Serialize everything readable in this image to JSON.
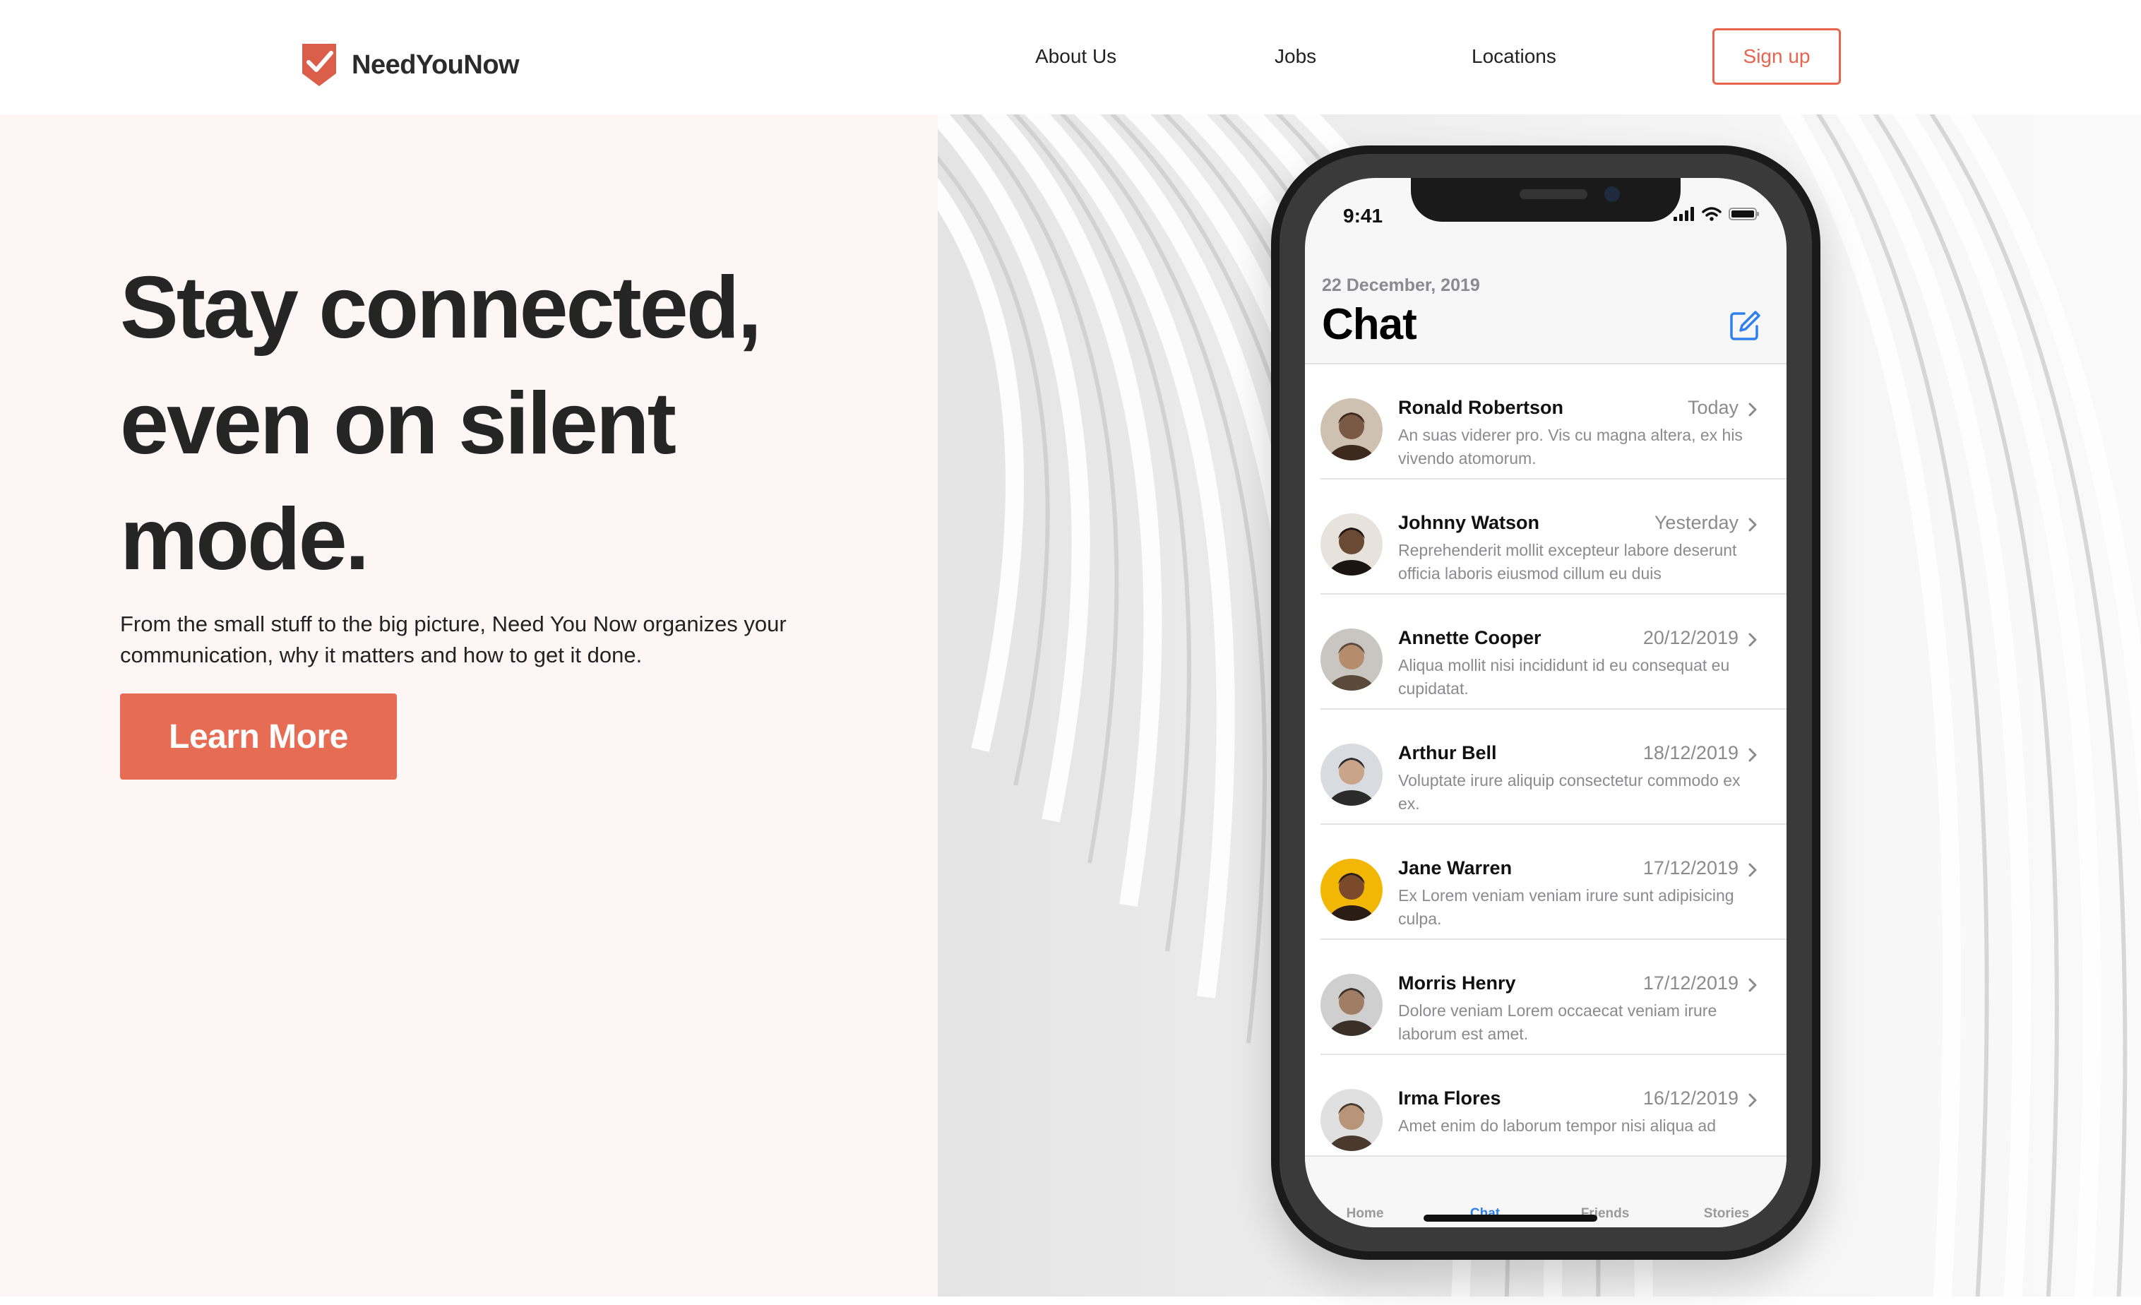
{
  "brand": {
    "name": "NeedYouNow",
    "accent": "#e8644e"
  },
  "nav": {
    "about": "About Us",
    "jobs": "Jobs",
    "locations": "Locations",
    "signup": "Sign up"
  },
  "hero": {
    "headline_line1": "Stay connected,",
    "headline_line2": "even on silent",
    "headline_line3": "mode.",
    "subtext": "From the small stuff to the big picture, Need You Now organizes your communication, why it matters and how to get it done.",
    "cta": "Learn More"
  },
  "phone": {
    "status_time": "9:41",
    "date": "22 December, 2019",
    "title": "Chat",
    "chats": [
      {
        "name": "Ronald Robertson",
        "date": "Today",
        "preview": "An suas viderer pro. Vis cu magna altera, ex his vivendo atomorum."
      },
      {
        "name": "Johnny Watson",
        "date": "Yesterday",
        "preview": "Reprehenderit mollit excepteur labore deserunt officia laboris eiusmod cillum eu duis"
      },
      {
        "name": "Annette Cooper",
        "date": "20/12/2019",
        "preview": "Aliqua mollit nisi incididunt id eu consequat eu cupidatat."
      },
      {
        "name": "Arthur Bell",
        "date": "18/12/2019",
        "preview": "Voluptate irure aliquip consectetur commodo ex ex."
      },
      {
        "name": "Jane Warren",
        "date": "17/12/2019",
        "preview": "Ex Lorem veniam veniam irure sunt adipisicing culpa."
      },
      {
        "name": "Morris Henry",
        "date": "17/12/2019",
        "preview": "Dolore veniam Lorem occaecat veniam irure laborum est amet."
      },
      {
        "name": "Irma Flores",
        "date": "16/12/2019",
        "preview": "Amet enim do laborum tempor nisi aliqua ad"
      }
    ],
    "tabs": {
      "home": "Home",
      "chat": "Chat",
      "friends": "Friends",
      "stories": "Stories"
    }
  }
}
